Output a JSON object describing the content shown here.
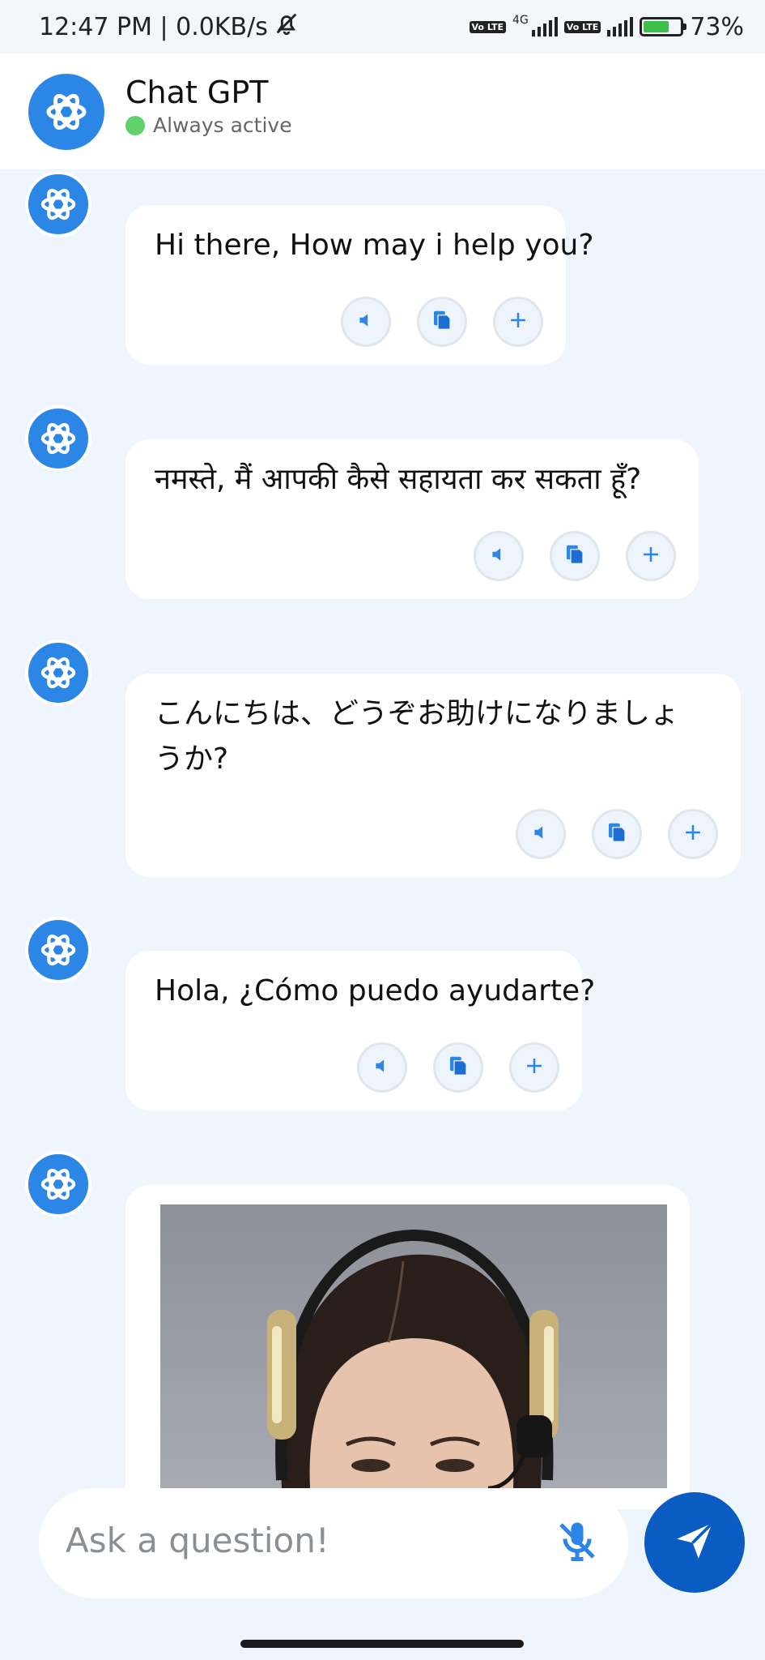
{
  "status_bar": {
    "time_speed": "12:47 PM | 0.0KB/s",
    "network_4g": "4G",
    "volte": "Vo LTE",
    "battery": "73%",
    "battery_level": 0.73
  },
  "header": {
    "title": "Chat GPT",
    "status": "Always active"
  },
  "messages": [
    {
      "text": "Hi there, How may i help you?"
    },
    {
      "text": "नमस्ते, मैं आपकी कैसे सहायता कर सकता हूँ?"
    },
    {
      "text": "こんにちは、どうぞお助けになりましょうか?"
    },
    {
      "text": "Hola, ¿Cómo puedo ayudarte?"
    }
  ],
  "image_message": {
    "alt": "woman-with-headset"
  },
  "composer": {
    "placeholder": "Ask a question!"
  },
  "colors": {
    "accent": "#2b86e6",
    "send_button": "#0a5cc2",
    "online": "#5fd16a",
    "background": "#eef5fd"
  },
  "icons": [
    "openai-logo-icon",
    "speaker-icon",
    "copy-icon",
    "plus-icon",
    "mic-off-icon",
    "send-icon",
    "mute-bell-icon",
    "battery-icon",
    "signal-icon"
  ]
}
